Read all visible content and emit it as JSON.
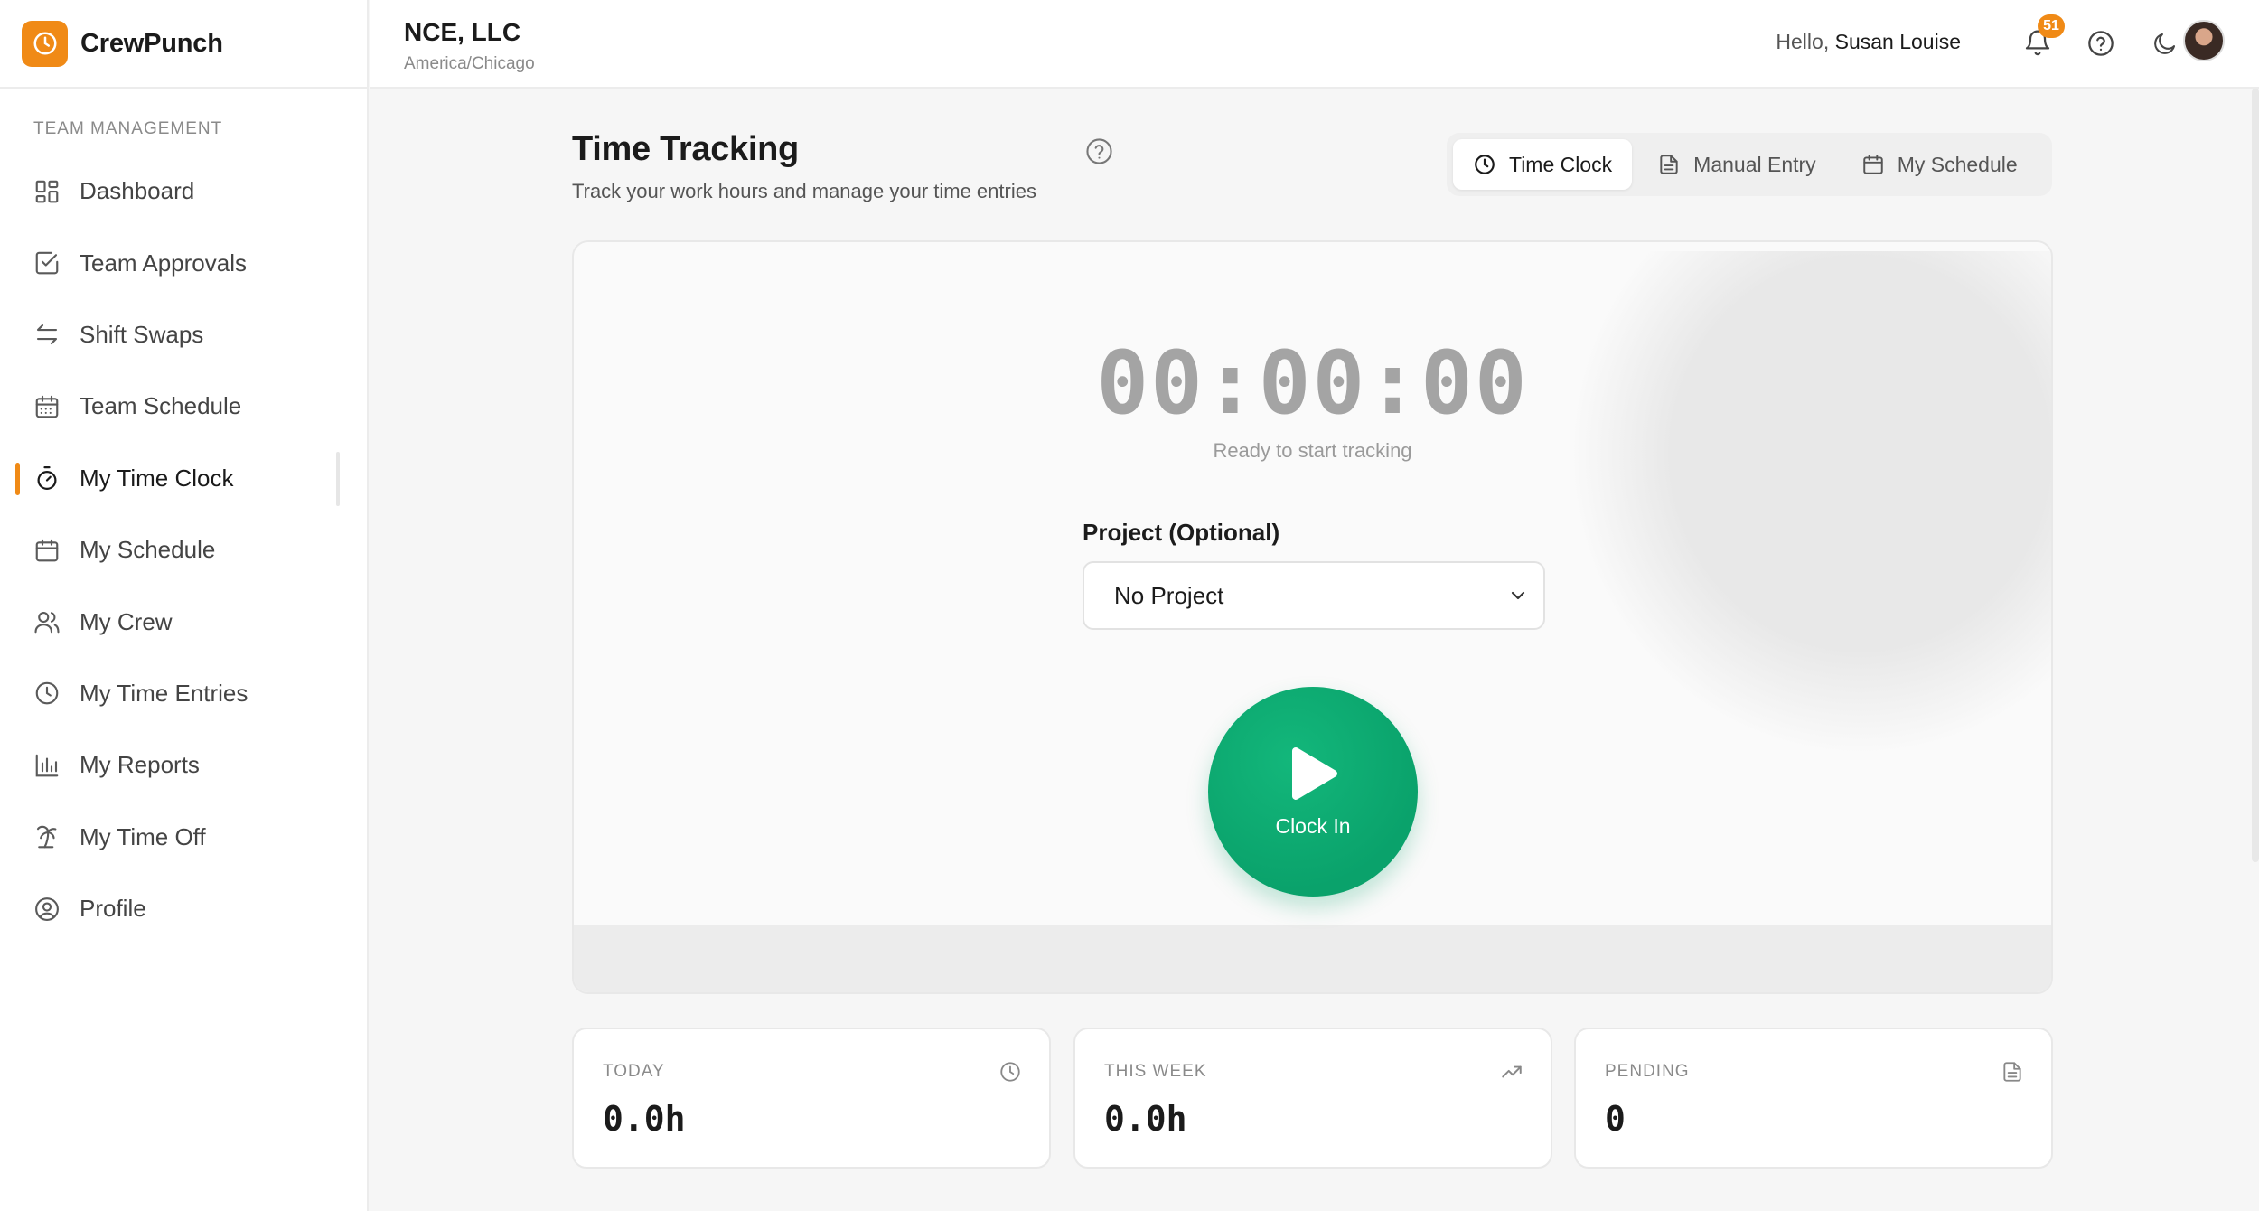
{
  "brand": {
    "name": "CrewPunch",
    "accent": "#f08a16"
  },
  "sidebar": {
    "section_label": "TEAM MANAGEMENT",
    "items": [
      {
        "label": "Dashboard",
        "icon": "dashboard-icon"
      },
      {
        "label": "Team Approvals",
        "icon": "checkbox-icon"
      },
      {
        "label": "Shift Swaps",
        "icon": "swap-arrows-icon"
      },
      {
        "label": "Team Schedule",
        "icon": "calendar-grid-icon"
      },
      {
        "label": "My Time Clock",
        "icon": "stopwatch-icon",
        "active": true
      },
      {
        "label": "My Schedule",
        "icon": "calendar-icon"
      },
      {
        "label": "My Crew",
        "icon": "users-icon"
      },
      {
        "label": "My Time Entries",
        "icon": "clock-icon"
      },
      {
        "label": "My Reports",
        "icon": "bar-chart-icon"
      },
      {
        "label": "My Time Off",
        "icon": "palm-tree-icon"
      },
      {
        "label": "Profile",
        "icon": "user-circle-icon"
      }
    ]
  },
  "header": {
    "org_name": "NCE, LLC",
    "timezone": "America/Chicago",
    "greeting_prefix": "Hello,",
    "user_name": "Susan Louise",
    "notification_count": "51"
  },
  "main": {
    "title": "Time Tracking",
    "subtitle": "Track your work hours and manage your time entries",
    "tabs": [
      {
        "label": "Time Clock",
        "icon": "clock-icon",
        "active": true
      },
      {
        "label": "Manual Entry",
        "icon": "document-icon"
      },
      {
        "label": "My Schedule",
        "icon": "calendar-icon"
      }
    ],
    "timer": {
      "display": "00:00:00",
      "status": "Ready to start tracking"
    },
    "project": {
      "label": "Project (Optional)",
      "selected": "No Project"
    },
    "clock_in_label": "Clock In",
    "clock_in_color": "#0aa26b",
    "stats": [
      {
        "label": "TODAY",
        "value": "0.0h",
        "icon": "clock-icon"
      },
      {
        "label": "THIS WEEK",
        "value": "0.0h",
        "icon": "trending-up-icon"
      },
      {
        "label": "PENDING",
        "value": "0",
        "icon": "document-icon"
      }
    ]
  }
}
